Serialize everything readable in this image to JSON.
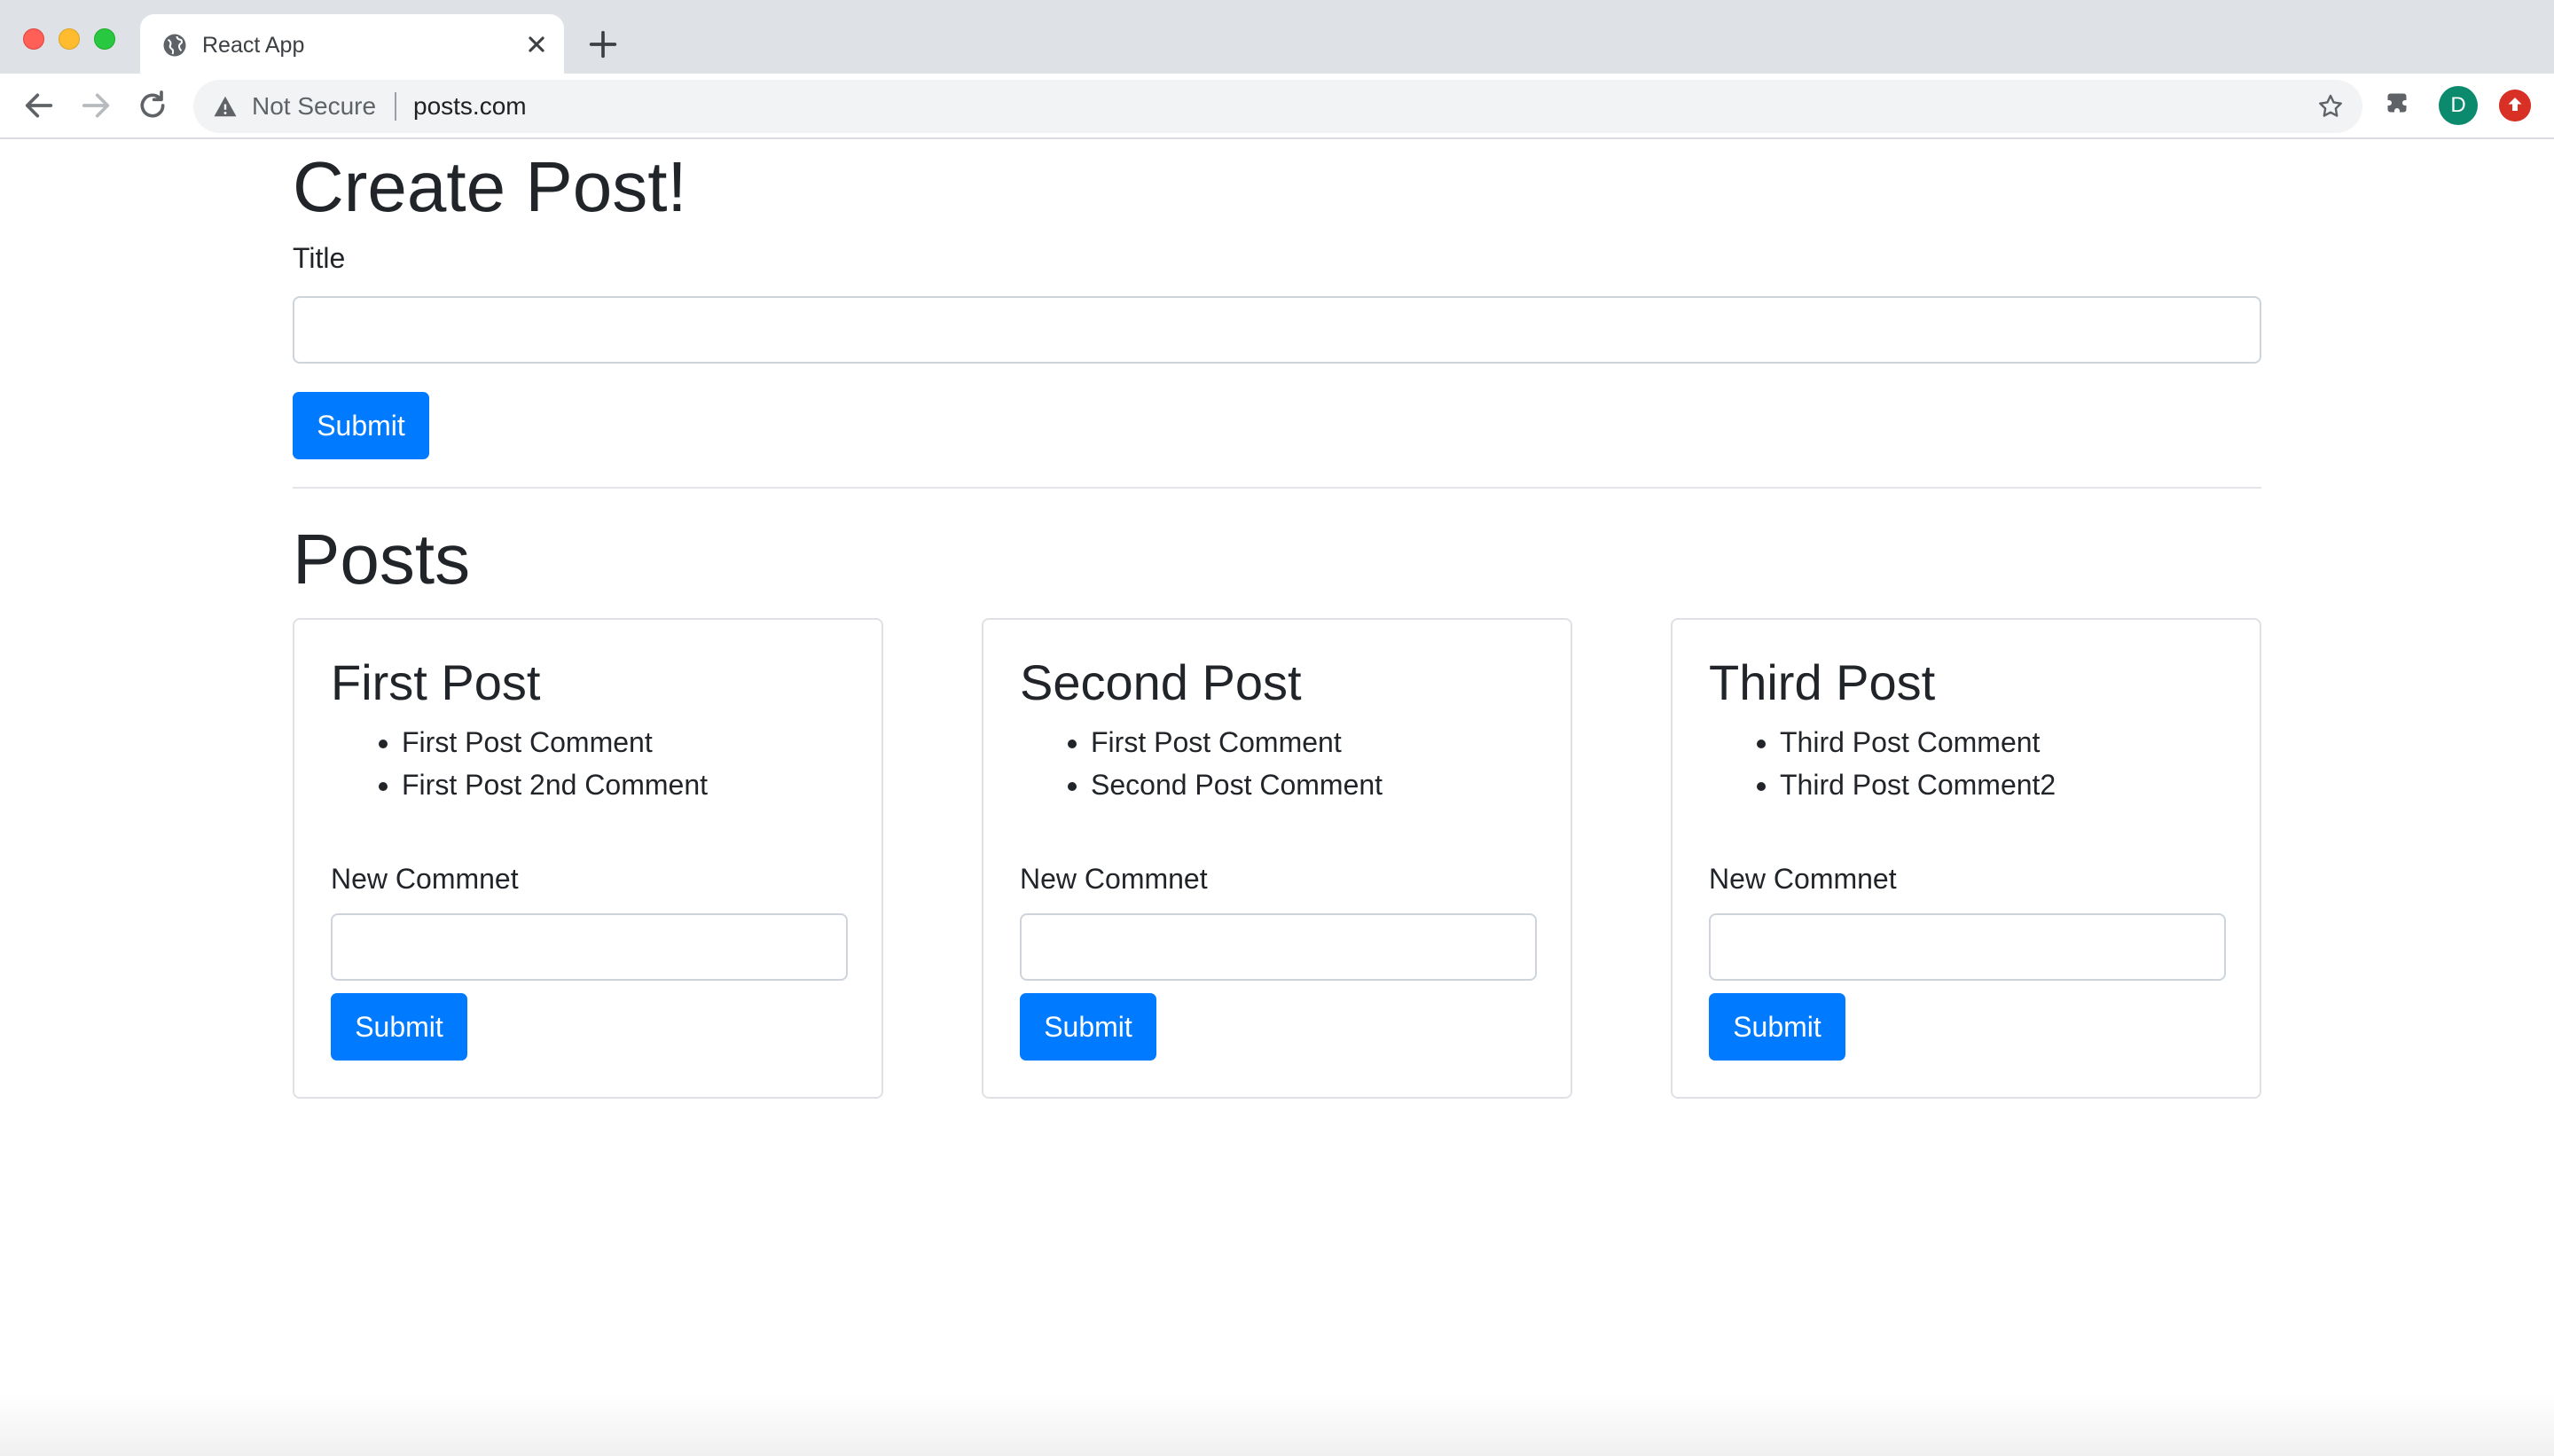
{
  "browser": {
    "tab_title": "React App",
    "security_label": "Not Secure",
    "url": "posts.com",
    "profile_initial": "D"
  },
  "create": {
    "heading": "Create Post!",
    "title_label": "Title",
    "title_value": "",
    "submit_label": "Submit"
  },
  "posts": {
    "heading": "Posts",
    "items": [
      {
        "title": "First Post",
        "comments": [
          "First Post Comment",
          "First Post 2nd Comment"
        ],
        "new_comment_label": "New Commnet",
        "new_comment_value": "",
        "submit_label": "Submit"
      },
      {
        "title": "Second Post",
        "comments": [
          "First Post Comment",
          "Second Post Comment"
        ],
        "new_comment_label": "New Commnet",
        "new_comment_value": "",
        "submit_label": "Submit"
      },
      {
        "title": "Third Post",
        "comments": [
          "Third Post Comment",
          "Third Post Comment2"
        ],
        "new_comment_label": "New Commnet",
        "new_comment_value": "",
        "submit_label": "Submit"
      }
    ]
  },
  "colors": {
    "primary": "#007bff",
    "text": "#212529",
    "border": "#ced4da"
  }
}
